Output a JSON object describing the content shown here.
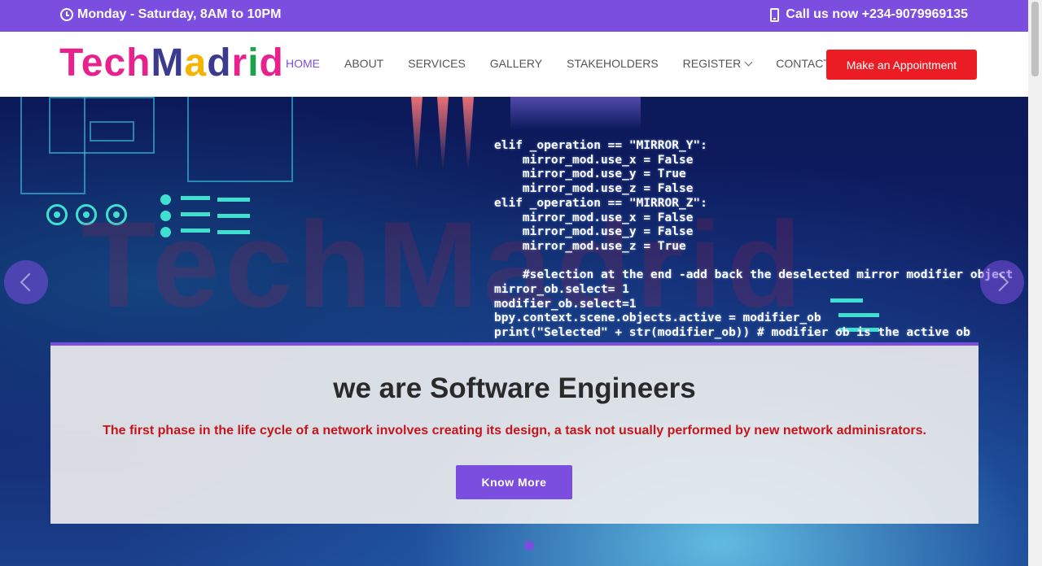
{
  "topbar": {
    "hours": "Monday - Saturday, 8AM to 10PM",
    "phone": "Call us now +234-9079969135",
    "icons": [
      "clock-icon",
      "mobile-phone-icon"
    ]
  },
  "logo": {
    "letters": [
      {
        "char": "T",
        "color": "#e8228c"
      },
      {
        "char": "e",
        "color": "#e8228c"
      },
      {
        "char": "c",
        "color": "#e8228c"
      },
      {
        "char": "h",
        "color": "#e8228c"
      },
      {
        "char": "M",
        "color": "#3b3a8f"
      },
      {
        "char": "a",
        "color": "#f4b400"
      },
      {
        "char": "d",
        "color": "#3b3a8f"
      },
      {
        "char": "r",
        "color": "#e8228c"
      },
      {
        "char": "i",
        "color": "#1aa34a"
      },
      {
        "char": "d",
        "color": "#e8228c"
      }
    ]
  },
  "nav": {
    "items": [
      "HOME",
      "ABOUT",
      "SERVICES",
      "GALLERY",
      "STAKEHOLDERS",
      "REGISTER",
      "CONTACT"
    ],
    "active": "HOME",
    "cta": "Make an Appointment"
  },
  "hero": {
    "watermark": "TechMadrid",
    "code_lines": [
      "elif _operation == \"MIRROR_Y\":",
      "    mirror_mod.use_x = False",
      "    mirror_mod.use_y = True",
      "    mirror_mod.use_z = False",
      "elif _operation == \"MIRROR_Z\":",
      "    mirror_mod.use_x = False",
      "    mirror_mod.use_y = False",
      "    mirror_mod.use_z = True",
      "",
      "    #selection at the end -add back the deselected mirror modifier object",
      "mirror_ob.select= 1",
      "modifier_ob.select=1",
      "bpy.context.scene.objects.active = modifier_ob",
      "print(\"Selected\" + str(modifier_ob)) # modifier ob is the active ob"
    ],
    "heading": "we are Software Engineers",
    "description": "The first phase in the life cycle of a network involves creating its design, a task not usually performed by new network adminisrators.",
    "button": "Know More"
  },
  "colors": {
    "accent": "#7b4ee0",
    "cta": "#ec1c24",
    "description": "#c4161c"
  }
}
